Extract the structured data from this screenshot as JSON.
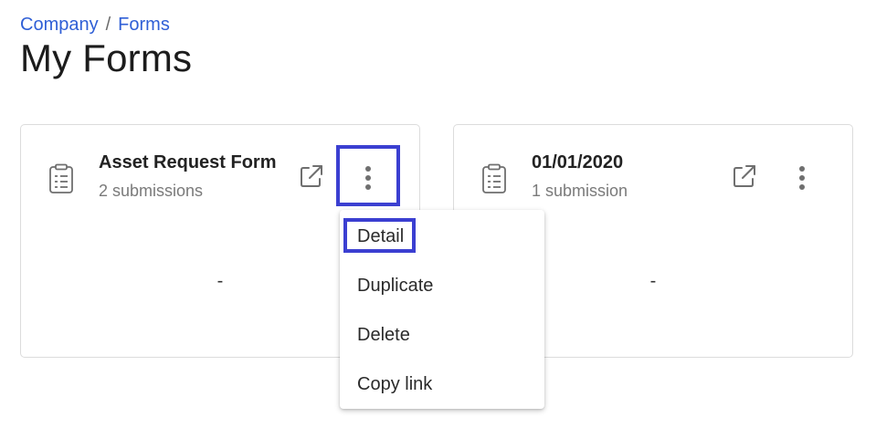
{
  "breadcrumb": {
    "items": [
      "Company",
      "Forms"
    ],
    "separator": "/"
  },
  "page_title": "My Forms",
  "forms": [
    {
      "name": "Asset Request Form",
      "submissions": "2 submissions",
      "body_value": "-",
      "icons": {
        "form": "clipboard-icon",
        "open": "external-link-icon",
        "more": "more-vert-icon"
      }
    },
    {
      "name": "01/01/2020",
      "submissions": "1 submission",
      "body_value": "-",
      "icons": {
        "form": "clipboard-icon",
        "open": "external-link-icon",
        "more": "more-vert-icon"
      }
    }
  ],
  "context_menu": {
    "items": [
      "Detail",
      "Duplicate",
      "Delete",
      "Copy link"
    ]
  },
  "colors": {
    "link": "#2f5fd6",
    "highlight": "#3b3fd1",
    "card_border": "#dcdcdc",
    "icon": "#6f6f6f"
  }
}
